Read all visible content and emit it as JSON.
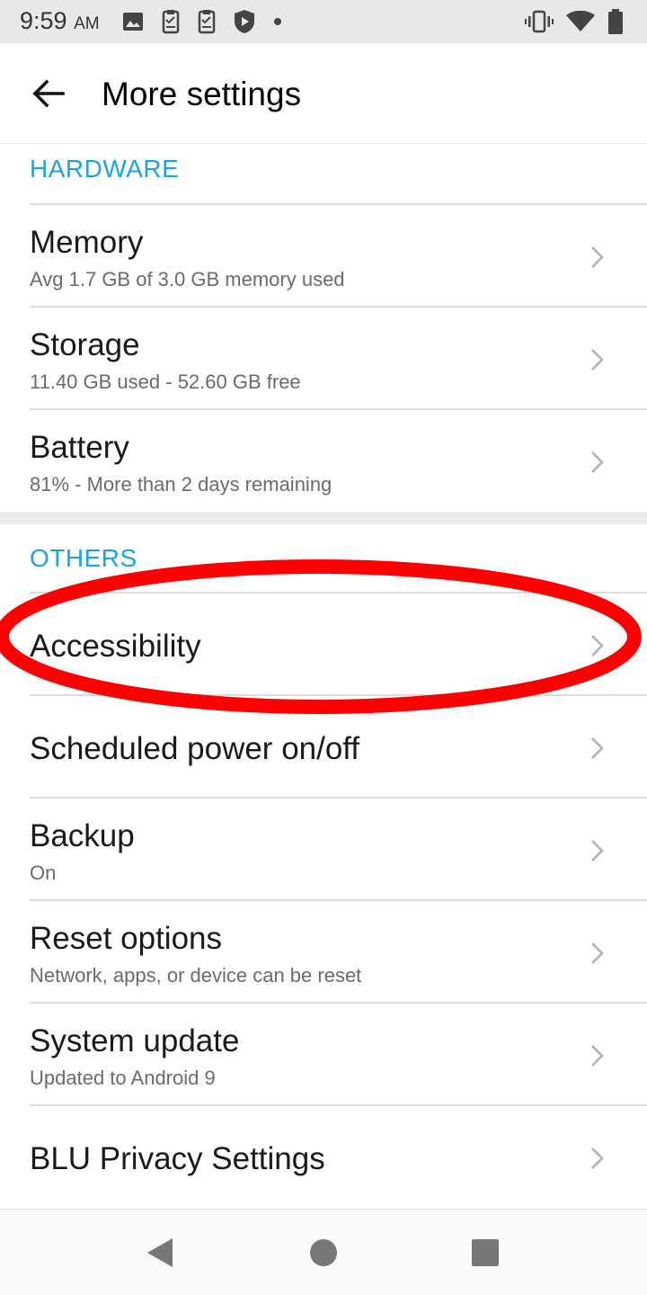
{
  "status_bar": {
    "time": "9:59",
    "ampm": "AM",
    "left_icons": [
      "image-icon",
      "clipboard-icon",
      "clipboard-icon",
      "shield-play-icon",
      "dot-icon"
    ],
    "right_icons": [
      "vibrate-icon",
      "wifi-icon",
      "battery-icon"
    ]
  },
  "app_bar": {
    "title": "More settings",
    "back_icon": "arrow-left-icon"
  },
  "sections": {
    "hardware": {
      "header": "HARDWARE",
      "items": [
        {
          "title": "Memory",
          "subtitle": "Avg 1.7 GB of 3.0 GB memory used"
        },
        {
          "title": "Storage",
          "subtitle": "11.40 GB used - 52.60 GB free"
        },
        {
          "title": "Battery",
          "subtitle": "81% - More than 2 days remaining"
        }
      ]
    },
    "others": {
      "header": "OTHERS",
      "items": [
        {
          "title": "Accessibility"
        },
        {
          "title": "Scheduled power on/off"
        },
        {
          "title": "Backup",
          "subtitle": "On"
        },
        {
          "title": "Reset options",
          "subtitle": "Network, apps, or device can be reset"
        },
        {
          "title": "System update",
          "subtitle": "Updated to Android 9"
        },
        {
          "title": "BLU Privacy Settings"
        }
      ]
    }
  },
  "annotation": {
    "color": "#ff0000",
    "target": "Accessibility"
  },
  "nav_bar": {
    "back_icon": "triangle-back-icon",
    "home_icon": "circle-home-icon",
    "recents_icon": "square-recents-icon"
  },
  "colors": {
    "accent": "#1aa3e8",
    "divider": "#dcdcdc"
  }
}
